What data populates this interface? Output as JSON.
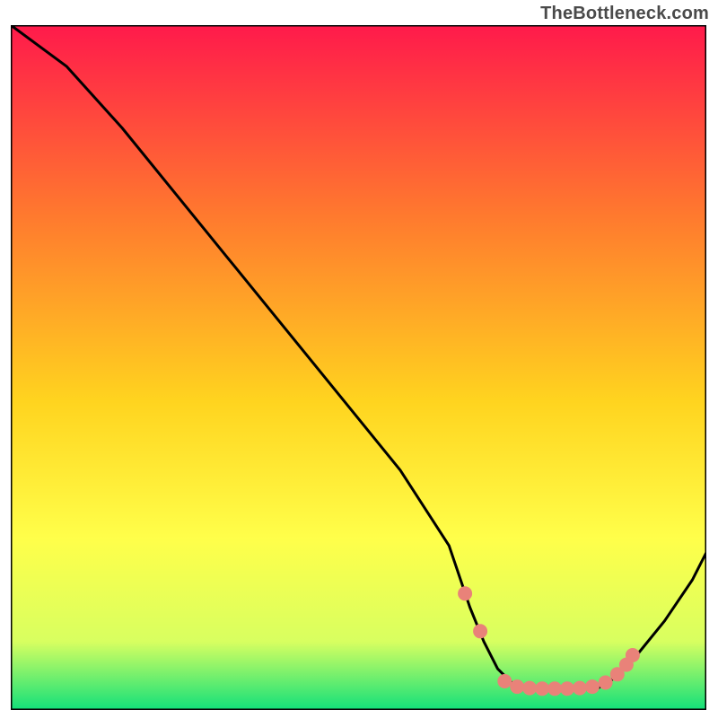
{
  "attribution": "TheBottleneck.com",
  "colors": {
    "gradient_top": "#ff1a4b",
    "gradient_mid1": "#ff7a2e",
    "gradient_mid2": "#ffd41f",
    "gradient_mid3": "#ffff4a",
    "gradient_mid4": "#d8ff60",
    "gradient_bottom": "#12e07a",
    "curve": "#000000",
    "marker": "#e98279",
    "frame": "#000000"
  },
  "chart_data": {
    "type": "line",
    "title": "",
    "xlabel": "",
    "ylabel": "",
    "xlim": [
      0,
      100
    ],
    "ylim": [
      0,
      100
    ],
    "grid": false,
    "legend": false,
    "series": [
      {
        "name": "bottleneck-curve",
        "x": [
          0,
          8,
          16,
          24,
          32,
          40,
          48,
          56,
          63,
          66,
          68,
          70,
          72,
          74,
          76,
          78,
          80,
          82,
          84,
          86,
          90,
          94,
          98,
          100
        ],
        "y": [
          100,
          94,
          85,
          75,
          65,
          55,
          45,
          35,
          24,
          15,
          10,
          6,
          4,
          3,
          3,
          3,
          3,
          3,
          3,
          4,
          8,
          13,
          19,
          23
        ]
      }
    ],
    "markers": {
      "name": "highlight-dots",
      "x": [
        65.3,
        67.5,
        71.0,
        72.8,
        74.6,
        76.4,
        78.2,
        80.0,
        81.8,
        83.6,
        85.5,
        87.2,
        88.5,
        89.4
      ],
      "y": [
        17.0,
        11.5,
        4.2,
        3.4,
        3.2,
        3.1,
        3.1,
        3.1,
        3.2,
        3.4,
        4.0,
        5.2,
        6.6,
        8.0
      ]
    }
  }
}
